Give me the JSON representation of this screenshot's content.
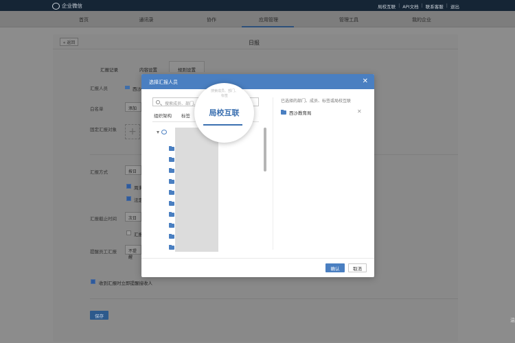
{
  "app": {
    "name": "企业微信"
  },
  "toplinks": [
    "局校互联",
    "API文档",
    "联系客服",
    "退出"
  ],
  "nav": {
    "items": [
      "首页",
      "通讯录",
      "协作",
      "应用管理",
      "管理工具",
      "我的企业"
    ],
    "active": "应用管理"
  },
  "page": {
    "back_label": "« 返回",
    "title": "日报",
    "tabs": [
      "汇报记录",
      "内容设置",
      "规则设置"
    ],
    "active_tab": "规则设置",
    "labels": {
      "reporter": "汇报人员",
      "whitelist": "白名单",
      "fixed_target": "固定汇报对象",
      "method": "汇报方式",
      "deadline": "汇报截止时间",
      "remind": "提醒员工汇报"
    },
    "reporter_value": "西沙",
    "whitelist_value": "添加",
    "method_value": "按日",
    "deadline_value": "次日",
    "remind_value": "不提醒",
    "checkbox_1": "周末",
    "checkbox_2": "法定",
    "checkbox_3": "汇报",
    "notify_label": "收到汇报时立即提醒接收人",
    "save_label": "保存",
    "corner_text": "温"
  },
  "modal": {
    "title": "选择汇报人员",
    "close": "✕",
    "search_placeholder": "搜索成员、部门、标签",
    "tabs": [
      "组织架构",
      "标签",
      "局校互联"
    ],
    "selected_title": "已选择的部门、成员、标签或局校互联",
    "selected_items": [
      {
        "label": "西沙教育局"
      }
    ],
    "remove": "✕",
    "ok_label": "确认",
    "cancel_label": "取消"
  },
  "magnifier": {
    "text": "局校互联"
  },
  "colors": {
    "accent": "#4a7fc1",
    "topbar": "#152535"
  }
}
